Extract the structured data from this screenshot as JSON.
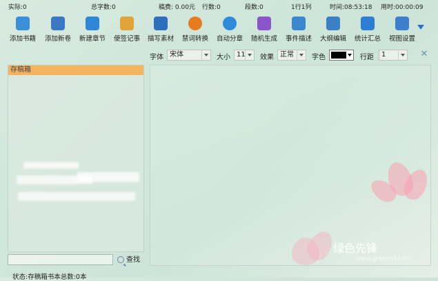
{
  "status_bar": {
    "actual": "实际:0",
    "total_chars": "总字数:0",
    "fee": "稿费: 0.00元",
    "lines": "行数:0",
    "paragraphs": "段数:0",
    "position": "1行1列",
    "time": "时间:08:53:18",
    "elapsed": "用时:00:00:09"
  },
  "toolbar": {
    "items": [
      {
        "label": "添加书籍",
        "icon": "add-book-icon",
        "color": "#3a8fd8"
      },
      {
        "label": "添加新卷",
        "icon": "add-volume-icon",
        "color": "#3b78c4"
      },
      {
        "label": "新建章节",
        "icon": "new-chapter-icon",
        "color": "#2f86d6"
      },
      {
        "label": "便签记事",
        "icon": "sticky-note-icon",
        "color": "#e0a43a"
      },
      {
        "label": "描写素材",
        "icon": "material-icon",
        "color": "#2d6fbf"
      },
      {
        "label": "禁词转换",
        "icon": "forbidden-word-icon",
        "color": "#e87a1f"
      },
      {
        "label": "自动分章",
        "icon": "auto-split-icon",
        "color": "#2f8ad9"
      },
      {
        "label": "随机生成",
        "icon": "random-generate-icon",
        "color": "#8a55c9"
      },
      {
        "label": "事件描述",
        "icon": "event-icon",
        "color": "#3a87d0"
      },
      {
        "label": "大纲编辑",
        "icon": "outline-icon",
        "color": "#3b7fc4"
      },
      {
        "label": "统计汇总",
        "icon": "statistics-icon",
        "color": "#2d7fd6"
      },
      {
        "label": "视图设置",
        "icon": "view-settings-icon",
        "color": "#3d7ecf"
      }
    ]
  },
  "format_bar": {
    "font_label": "字体",
    "font_value": "宋体",
    "size_label": "大小",
    "size_value": "11",
    "effect_label": "效果",
    "effect_value": "正常",
    "color_label": "字色",
    "color_value": "#000000",
    "spacing_label": "行距",
    "spacing_value": "1"
  },
  "left_panel": {
    "header": "存稿箱"
  },
  "search": {
    "button_label": "查找",
    "value": ""
  },
  "bottom_status": "状态:存稿箱书本总数:0本",
  "watermark": "绿色先锋",
  "watermark_url": "www.greenxf.com"
}
